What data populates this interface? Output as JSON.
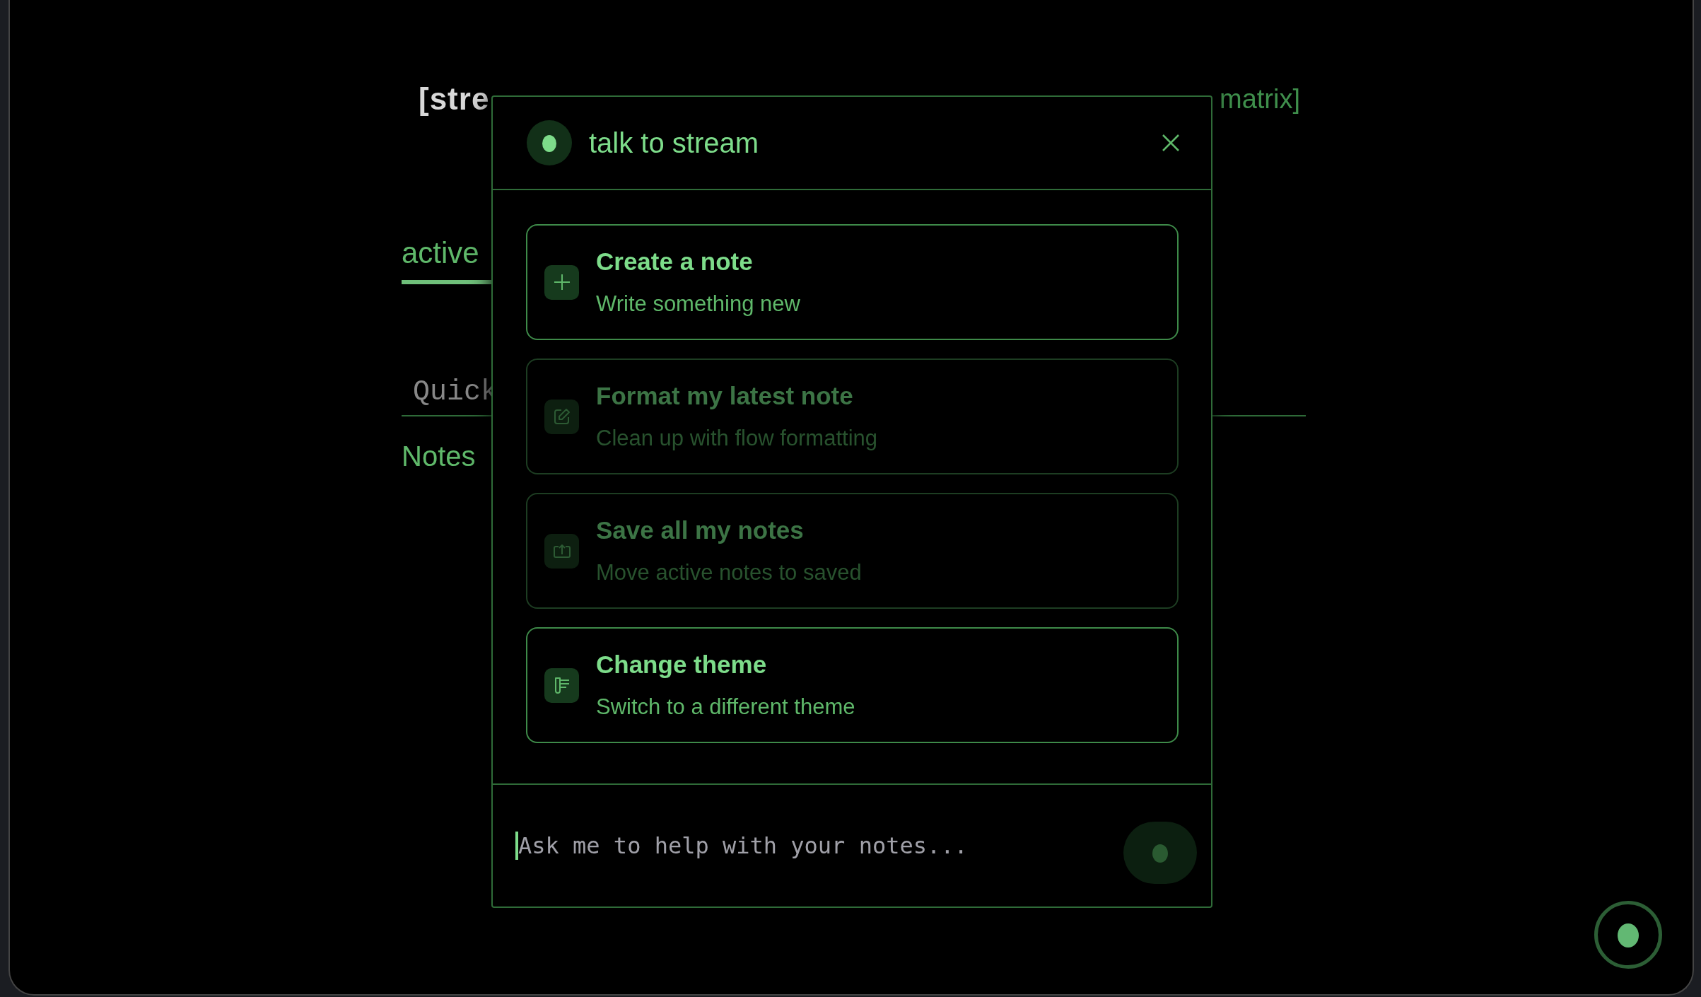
{
  "header": {
    "logo": "[stre",
    "link": "matrix]"
  },
  "tabs": [
    {
      "label": "active",
      "selected": true
    }
  ],
  "quick_field": {
    "placeholder": "Quick"
  },
  "notes_label": "Notes",
  "dialog": {
    "title": "talk to stream",
    "actions": [
      {
        "kind": "create",
        "title": "Create a note",
        "subtitle": "Write something new",
        "disabled": false
      },
      {
        "kind": "format",
        "title": "Format my latest note",
        "subtitle": "Clean up with flow formatting",
        "disabled": true
      },
      {
        "kind": "save",
        "title": "Save all my notes",
        "subtitle": "Move active notes to saved",
        "disabled": true
      },
      {
        "kind": "theme",
        "title": "Change theme",
        "subtitle": "Switch to a different theme",
        "disabled": false
      }
    ],
    "input": {
      "placeholder": "Ask me to help with your notes..."
    },
    "send_disabled": true
  }
}
